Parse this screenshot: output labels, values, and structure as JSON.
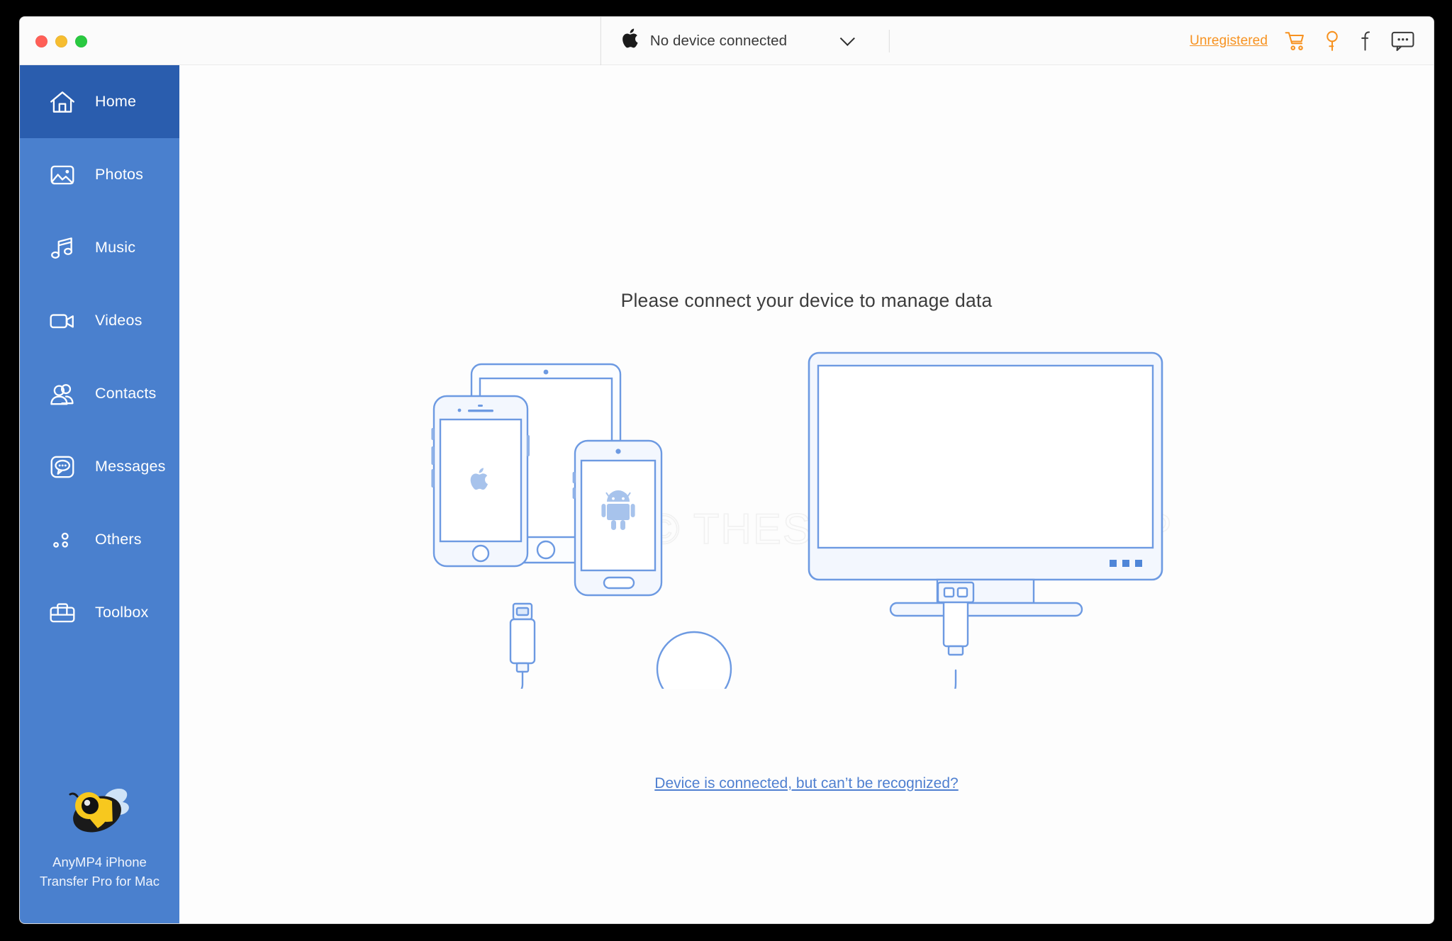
{
  "window": {
    "traffic_lights": [
      {
        "name": "close",
        "color": "#ff5f57"
      },
      {
        "name": "minimize",
        "color": "#f6bd30"
      },
      {
        "name": "maximize",
        "color": "#29c940"
      }
    ]
  },
  "titlebar": {
    "apple_glyph": "",
    "device_label": "No device connected",
    "dropdown_icon": "chevron-down-icon",
    "unregistered_label": "Unregistered",
    "unregistered_color": "#f79220",
    "icons": [
      {
        "name": "cart-icon",
        "color": "#f79220"
      },
      {
        "name": "key-icon",
        "color": "#f79220"
      },
      {
        "name": "facebook-icon",
        "color": "#3a3a3a"
      },
      {
        "name": "feedback-icon",
        "color": "#3a3a3a"
      }
    ]
  },
  "sidebar": {
    "bg_color": "#4a80ce",
    "active_bg_color": "#2a5dae",
    "items": [
      {
        "label": "Home",
        "icon": "home-icon",
        "active": true
      },
      {
        "label": "Photos",
        "icon": "photos-icon",
        "active": false
      },
      {
        "label": "Music",
        "icon": "music-icon",
        "active": false
      },
      {
        "label": "Videos",
        "icon": "videos-icon",
        "active": false
      },
      {
        "label": "Contacts",
        "icon": "contacts-icon",
        "active": false
      },
      {
        "label": "Messages",
        "icon": "messages-icon",
        "active": false
      },
      {
        "label": "Others",
        "icon": "others-icon",
        "active": false
      },
      {
        "label": "Toolbox",
        "icon": "toolbox-icon",
        "active": false
      }
    ],
    "brand": {
      "logo_icon": "bee-logo-icon",
      "name": "AnyMP4 iPhone Transfer Pro for Mac"
    }
  },
  "main": {
    "heading": "Please connect your device to manage data",
    "watermark": "Copyright © THESOFTWARE.SHOP",
    "recognize_link": "Device is connected, but can’t be recognized?",
    "link_color": "#4e7fd0",
    "illustration": {
      "stroke_color": "#6d9ae2",
      "fill_color": "#f2f6fd",
      "devices": [
        "tablet",
        "iphone",
        "android-phone",
        "monitor"
      ],
      "cable": {
        "left_connector": "lightning-connector",
        "right_connector": "usb-connector"
      },
      "iphone_logo": "apple-logo",
      "android_logo": "android-robot-logo"
    }
  }
}
